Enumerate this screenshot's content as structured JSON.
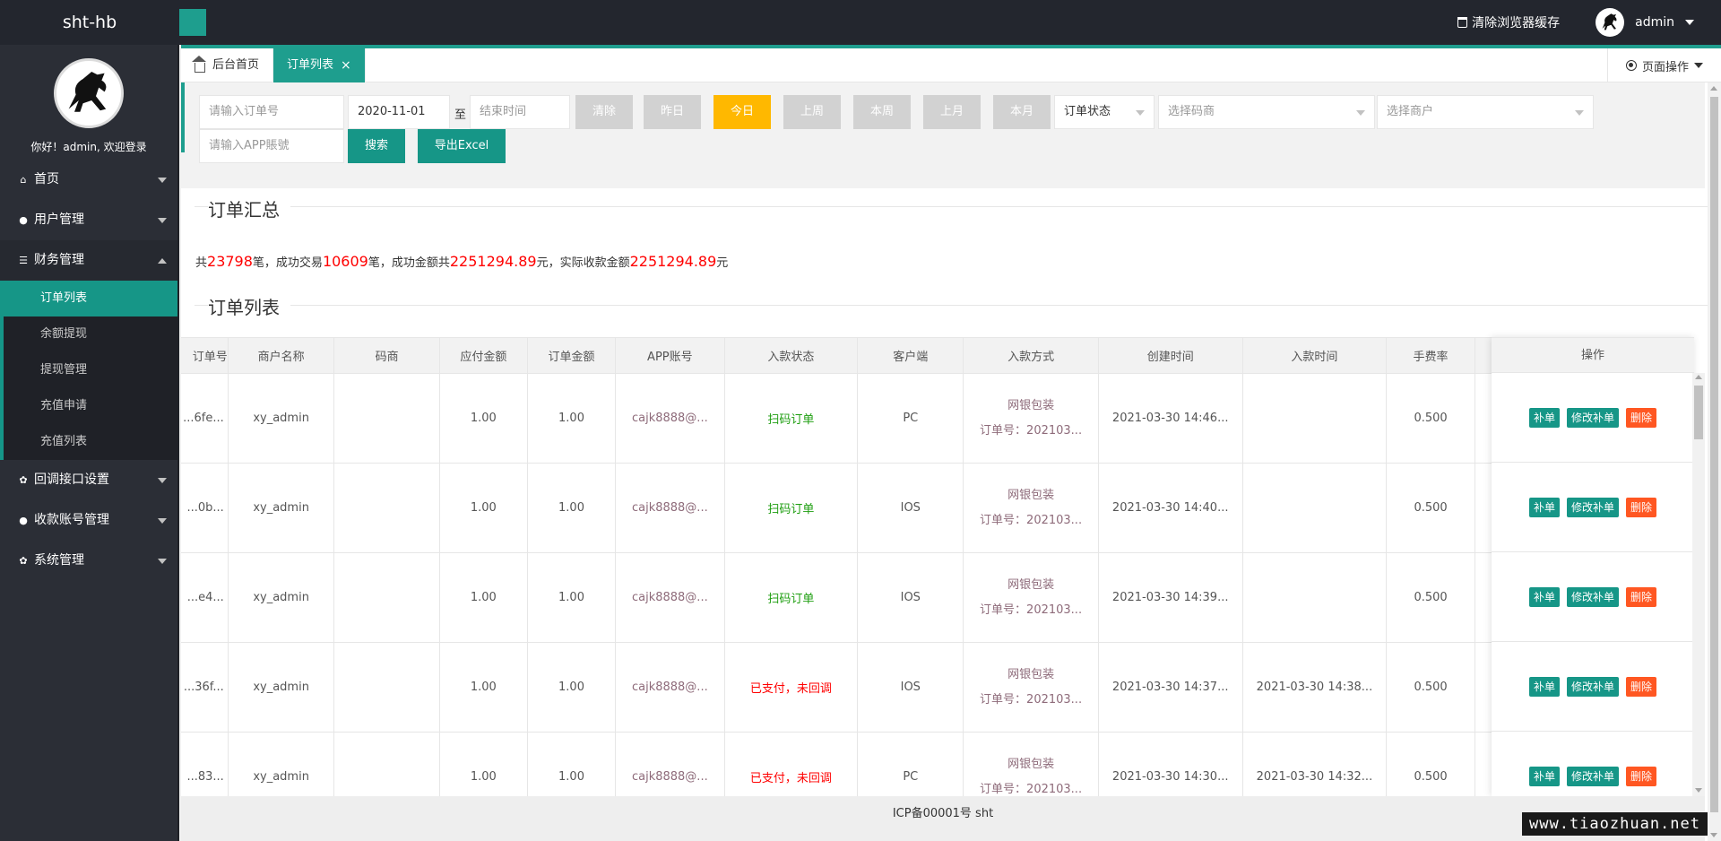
{
  "app": {
    "logo": "sht-hb",
    "clear_cache": "清除浏览器缓存",
    "username": "admin"
  },
  "sidebar": {
    "welcome": "你好！admin, 欢迎登录",
    "items": [
      {
        "label": "首页",
        "icon": "home-icon"
      },
      {
        "label": "用户管理",
        "icon": "user-icon"
      },
      {
        "label": "财务管理",
        "icon": "list-icon"
      },
      {
        "label": "回调接口设置",
        "icon": "gear-icon"
      },
      {
        "label": "收款账号管理",
        "icon": "users-icon"
      },
      {
        "label": "系统管理",
        "icon": "gear-icon"
      }
    ],
    "finance_sub": [
      "订单列表",
      "余额提现",
      "提现管理",
      "充值申请",
      "充值列表"
    ]
  },
  "tabs": {
    "home": "后台首页",
    "orders": "订单列表",
    "page_ops": "页面操作"
  },
  "filters": {
    "order_no_placeholder": "请输入订单号",
    "start_date": "2020-11-01",
    "to": "至",
    "end_placeholder": "结束时间",
    "clear": "清除",
    "yesterday": "昨日",
    "today": "今日",
    "last_week": "上周",
    "this_week": "本周",
    "last_month": "上月",
    "this_month": "本月",
    "order_status": "订单状态",
    "merchant_code_placeholder": "选择码商",
    "merchant_placeholder": "选择商户",
    "app_account_placeholder": "请输入APP賬號",
    "search": "搜索",
    "export": "导出Excel"
  },
  "summary": {
    "title": "订单汇总",
    "p1": "共",
    "total": "23798",
    "p2": "笔，成功交易",
    "success": "10609",
    "p3": "笔，成功金额共",
    "success_amount": "2251294.89",
    "p4": "元，实际收款金额",
    "actual_amount": "2251294.89",
    "p5": "元"
  },
  "list_title": "订单列表",
  "table": {
    "headers": [
      "订单号",
      "商户名称",
      "码商",
      "应付金额",
      "订单金额",
      "APP账号",
      "入款状态",
      "客户端",
      "入款方式",
      "创建时间",
      "入款时间",
      "手费率"
    ],
    "ops_header": "操作",
    "ops": {
      "fill": "补单",
      "edit_fill": "修改补单",
      "delete": "删除"
    },
    "rows": [
      {
        "order": "...6fe...",
        "merchant": "xy_admin",
        "code_merchant": "",
        "payable": "1.00",
        "amount": "1.00",
        "app": "cajk8888@...",
        "status": "扫码订单",
        "status_type": "green",
        "client": "PC",
        "pay_method": "网银包装",
        "pay_order": "订单号：202103...",
        "created": "2021-03-30 14:46...",
        "paid": "",
        "rate": "0.500"
      },
      {
        "order": "...0b...",
        "merchant": "xy_admin",
        "code_merchant": "",
        "payable": "1.00",
        "amount": "1.00",
        "app": "cajk8888@...",
        "status": "扫码订单",
        "status_type": "green",
        "client": "IOS",
        "pay_method": "网银包装",
        "pay_order": "订单号：202103...",
        "created": "2021-03-30 14:40...",
        "paid": "",
        "rate": "0.500"
      },
      {
        "order": "...e4...",
        "merchant": "xy_admin",
        "code_merchant": "",
        "payable": "1.00",
        "amount": "1.00",
        "app": "cajk8888@...",
        "status": "扫码订单",
        "status_type": "green",
        "client": "IOS",
        "pay_method": "网银包装",
        "pay_order": "订单号：202103...",
        "created": "2021-03-30 14:39...",
        "paid": "",
        "rate": "0.500"
      },
      {
        "order": "...36f...",
        "merchant": "xy_admin",
        "code_merchant": "",
        "payable": "1.00",
        "amount": "1.00",
        "app": "cajk8888@...",
        "status": "已支付，未回调",
        "status_type": "red",
        "client": "IOS",
        "pay_method": "网银包装",
        "pay_order": "订单号：202103...",
        "created": "2021-03-30 14:37...",
        "paid": "2021-03-30 14:38...",
        "rate": "0.500"
      },
      {
        "order": "...83...",
        "merchant": "xy_admin",
        "code_merchant": "",
        "payable": "1.00",
        "amount": "1.00",
        "app": "cajk8888@...",
        "status": "已支付，未回调",
        "status_type": "red",
        "client": "PC",
        "pay_method": "网银包装",
        "pay_order": "订单号：202103...",
        "created": "2021-03-30 14:30...",
        "paid": "2021-03-30 14:32...",
        "rate": "0.500"
      }
    ]
  },
  "footer": "ICP备00001号 sht",
  "watermark": "www.tiaozhuan.net",
  "colors": {
    "accent": "#1e9e8e",
    "header_bg": "#23262e",
    "sidebar_bg": "#2b2e36",
    "today": "#ffb800",
    "danger": "#ff5722"
  }
}
